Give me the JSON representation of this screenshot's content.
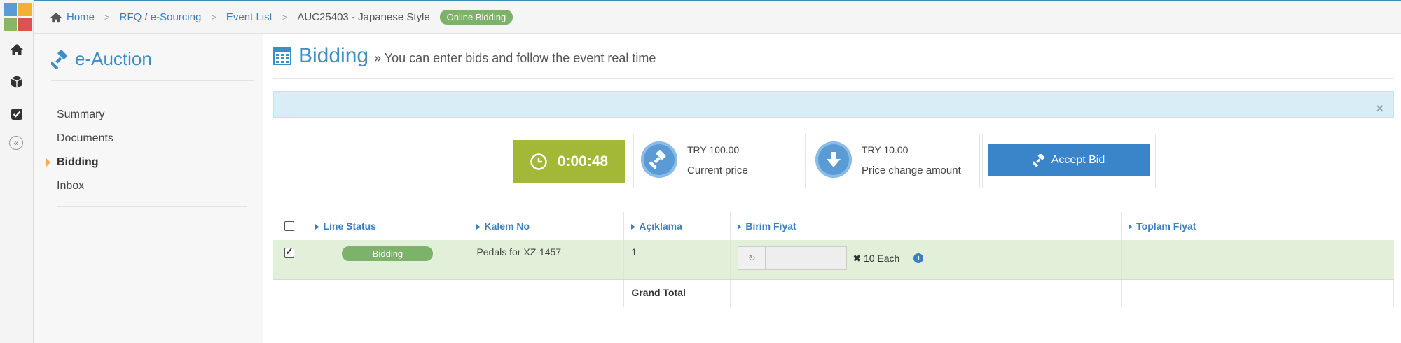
{
  "breadcrumb": {
    "items": [
      "Home",
      "RFQ / e-Sourcing",
      "Event List"
    ],
    "current": "AUC25403 - Japanese Style",
    "status": "Online Bidding"
  },
  "sidebar": {
    "title": "e-Auction",
    "items": [
      {
        "label": "Summary",
        "active": false
      },
      {
        "label": "Documents",
        "active": false
      },
      {
        "label": "Bidding",
        "active": true
      },
      {
        "label": "Inbox",
        "active": false
      }
    ]
  },
  "page": {
    "title": "Bidding",
    "subtitle": "» You can enter bids and follow the event real time"
  },
  "alert": {
    "close_symbol": "×"
  },
  "timer": {
    "value": "0:00:48"
  },
  "current_price": {
    "amount": "TRY 100.00",
    "label": "Current price"
  },
  "price_change": {
    "amount": "TRY 10.00",
    "label": "Price change amount"
  },
  "accept": {
    "label": "Accept Bid"
  },
  "table": {
    "headers": [
      "Line Status",
      "Kalem No",
      "Açıklama",
      "Birim Fiyat",
      "Toplam Fiyat"
    ],
    "rows": [
      {
        "checked": true,
        "status": "Bidding",
        "kalem_no": "Pedals for XZ-1457",
        "aciklama": "1",
        "qty": "✖ 10 Each",
        "toplam": ""
      }
    ],
    "total_label": "Grand Total"
  },
  "colors": {
    "accent": "#3a8fc8",
    "timer": "#a3b836",
    "status_green": "#7cb26a",
    "row_bg": "#e2f0d9"
  },
  "icons": [
    "home-icon",
    "cube-icon",
    "check-square-icon",
    "collapse-icon",
    "gavel-icon",
    "calculator-icon",
    "clock-icon",
    "arrow-down-icon",
    "info-icon"
  ]
}
